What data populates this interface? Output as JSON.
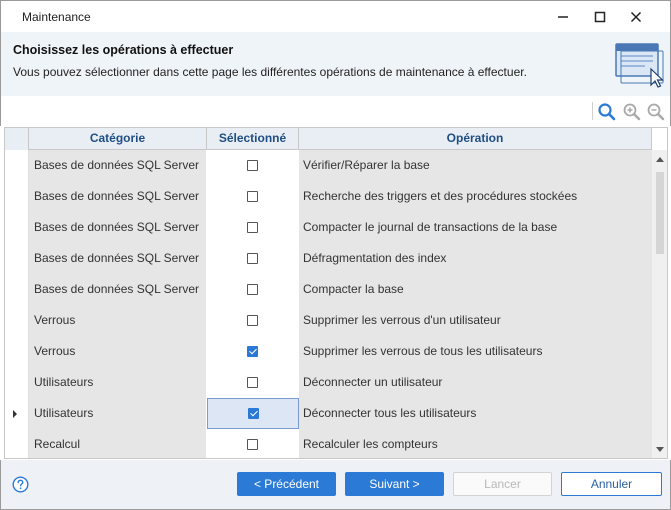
{
  "window": {
    "title": "Maintenance"
  },
  "header": {
    "title": "Choisissez les opérations à effectuer",
    "subtitle": "Vous pouvez sélectionner dans cette page les différentes opérations de maintenance à effectuer."
  },
  "grid": {
    "columns": {
      "category": "Catégorie",
      "selected": "Sélectionné",
      "operation": "Opération"
    },
    "rows": [
      {
        "category": "Bases de données SQL Server",
        "selected": false,
        "operation": "Vérifier/Réparer la base",
        "current": false
      },
      {
        "category": "Bases de données SQL Server",
        "selected": false,
        "operation": "Recherche des triggers et des procédures stockées",
        "current": false
      },
      {
        "category": "Bases de données SQL Server",
        "selected": false,
        "operation": "Compacter le journal de transactions de la base",
        "current": false
      },
      {
        "category": "Bases de données SQL Server",
        "selected": false,
        "operation": "Défragmentation des index",
        "current": false
      },
      {
        "category": "Bases de données SQL Server",
        "selected": false,
        "operation": "Compacter la base",
        "current": false
      },
      {
        "category": "Verrous",
        "selected": false,
        "operation": "Supprimer les verrous d'un utilisateur",
        "current": false
      },
      {
        "category": "Verrous",
        "selected": true,
        "operation": "Supprimer les verrous de tous les utilisateurs",
        "current": false
      },
      {
        "category": "Utilisateurs",
        "selected": false,
        "operation": "Déconnecter un utilisateur",
        "current": false
      },
      {
        "category": "Utilisateurs",
        "selected": true,
        "operation": "Déconnecter tous les utilisateurs",
        "current": true
      },
      {
        "category": "Recalcul",
        "selected": false,
        "operation": "Recalculer les compteurs",
        "current": false
      }
    ]
  },
  "footer": {
    "prev_label": "< Précédent",
    "next_label": "Suivant >",
    "launch_label": "Lancer",
    "cancel_label": "Annuler"
  },
  "colors": {
    "accent": "#2b7ad6",
    "header_bg": "#eff4f9",
    "column_header_text": "#1f4e84"
  },
  "icons": [
    "minimize-icon",
    "maximize-icon",
    "close-icon",
    "window-cursor-icon",
    "search-icon",
    "zoom-in-icon",
    "zoom-out-icon",
    "help-icon"
  ]
}
